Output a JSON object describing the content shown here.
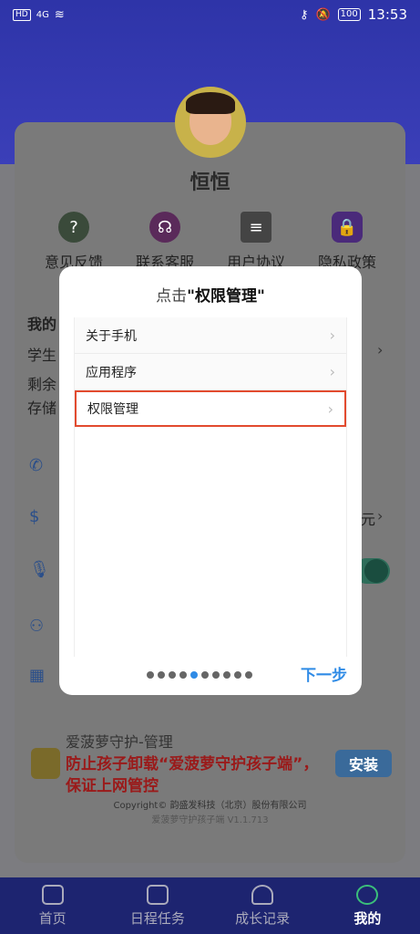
{
  "status_bar": {
    "left_badge": "HD",
    "signal": "4G",
    "time": "13:53",
    "battery": "100"
  },
  "profile": {
    "name": "恒恒"
  },
  "quick_actions": [
    {
      "label": "意见反馈",
      "icon": "question-icon"
    },
    {
      "label": "联系客服",
      "icon": "headset-icon"
    },
    {
      "label": "用户协议",
      "icon": "document-icon"
    },
    {
      "label": "隐私政策",
      "icon": "lock-icon"
    }
  ],
  "background_fragments": {
    "section_title": "我的",
    "line1": "学生",
    "line2": "剩余",
    "line3": "存储",
    "price_suffix": "元"
  },
  "ad": {
    "title": "爱菠萝守护-管理",
    "headline": "防止孩子卸载“爱菠萝守护孩子端”，保证上网管控",
    "install_label": "安装",
    "copyright": "Copyright© 韵盛发科技（北京）股份有限公司",
    "version": "爱菠萝守护孩子端 V1.1.713"
  },
  "bottom_nav": [
    {
      "label": "首页",
      "icon": "home-icon",
      "active": false
    },
    {
      "label": "日程任务",
      "icon": "calendar-icon",
      "active": false
    },
    {
      "label": "成长记录",
      "icon": "sprout-icon",
      "active": false
    },
    {
      "label": "我的",
      "icon": "user-icon",
      "active": true
    }
  ],
  "modal": {
    "title_prefix": "点击",
    "title_highlight": "\"权限管理\"",
    "menu_items": [
      {
        "label": "关于手机"
      },
      {
        "label": "应用程序"
      },
      {
        "label": "权限管理"
      }
    ],
    "highlighted_item_index": 2,
    "page_count": 10,
    "active_page": 4,
    "next_label": "下一步"
  },
  "colors": {
    "accent": "#2f8be6",
    "highlight_border": "#e24a2e",
    "nav_bg": "#1d2470"
  }
}
